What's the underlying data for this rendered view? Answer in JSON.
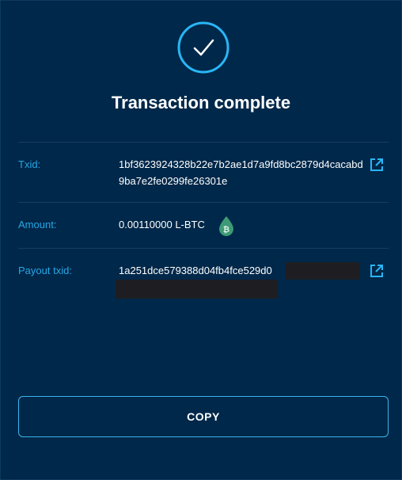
{
  "title": "Transaction complete",
  "txid": {
    "label": "Txid:",
    "value": "1bf3623924328b22e7b2ae1d7a9fd8bc2879d4cacabd9ba7e2fe0299fe26301e"
  },
  "amount": {
    "label": "Amount:",
    "value": "0.00110000 L-BTC",
    "asset_icon": "liquid-bitcoin-icon"
  },
  "payout": {
    "label": "Payout txid:",
    "value": "1a251dce579388d04fb4fce529d0"
  },
  "copy_button": "COPY",
  "colors": {
    "background": "#00284a",
    "accent": "#28a6e6",
    "asset_green": "#3e9a76"
  }
}
